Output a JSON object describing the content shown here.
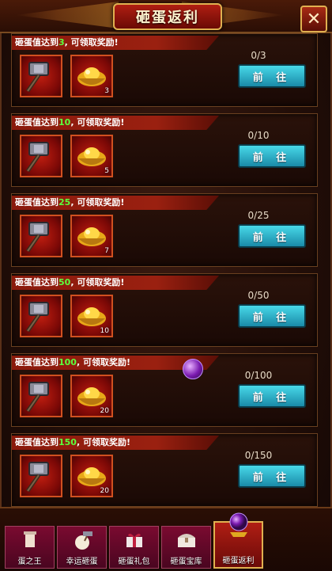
{
  "window": {
    "title": "砸蛋返利",
    "close_label": "✕"
  },
  "rewards": [
    {
      "prefix": "砸蛋值达到",
      "threshold": "3",
      "suffix": ", 可领取奖励!",
      "progress": "0/3",
      "button": "前 往",
      "item1_count": "",
      "item2_count": "3"
    },
    {
      "prefix": "砸蛋值达到",
      "threshold": "10",
      "suffix": ", 可领取奖励!",
      "progress": "0/10",
      "button": "前 往",
      "item1_count": "",
      "item2_count": "5"
    },
    {
      "prefix": "砸蛋值达到",
      "threshold": "25",
      "suffix": ", 可领取奖励!",
      "progress": "0/25",
      "button": "前 往",
      "item1_count": "",
      "item2_count": "7"
    },
    {
      "prefix": "砸蛋值达到",
      "threshold": "50",
      "suffix": ", 可领取奖励!",
      "progress": "0/50",
      "button": "前 往",
      "item1_count": "",
      "item2_count": "10"
    },
    {
      "prefix": "砸蛋值达到",
      "threshold": "100",
      "suffix": ", 可领取奖励!",
      "progress": "0/100",
      "button": "前 往",
      "item1_count": "",
      "item2_count": "20"
    },
    {
      "prefix": "砸蛋值达到",
      "threshold": "150",
      "suffix": ", 可领取奖励!",
      "progress": "0/150",
      "button": "前 往",
      "item1_count": "",
      "item2_count": "20"
    }
  ],
  "tabs": [
    {
      "label": "蛋之王",
      "icon": "tower-icon"
    },
    {
      "label": "幸运砸蛋",
      "icon": "egg-hammer-icon"
    },
    {
      "label": "砸蛋礼包",
      "icon": "gift-box-icon"
    },
    {
      "label": "砸蛋宝库",
      "icon": "treasure-chest-icon"
    },
    {
      "label": "砸蛋返利",
      "icon": "treasure-orb-icon"
    }
  ],
  "colors": {
    "threshold_green": "#5cff3c",
    "button_cyan": "#34b8d0",
    "accent_gold": "#e0b050"
  }
}
